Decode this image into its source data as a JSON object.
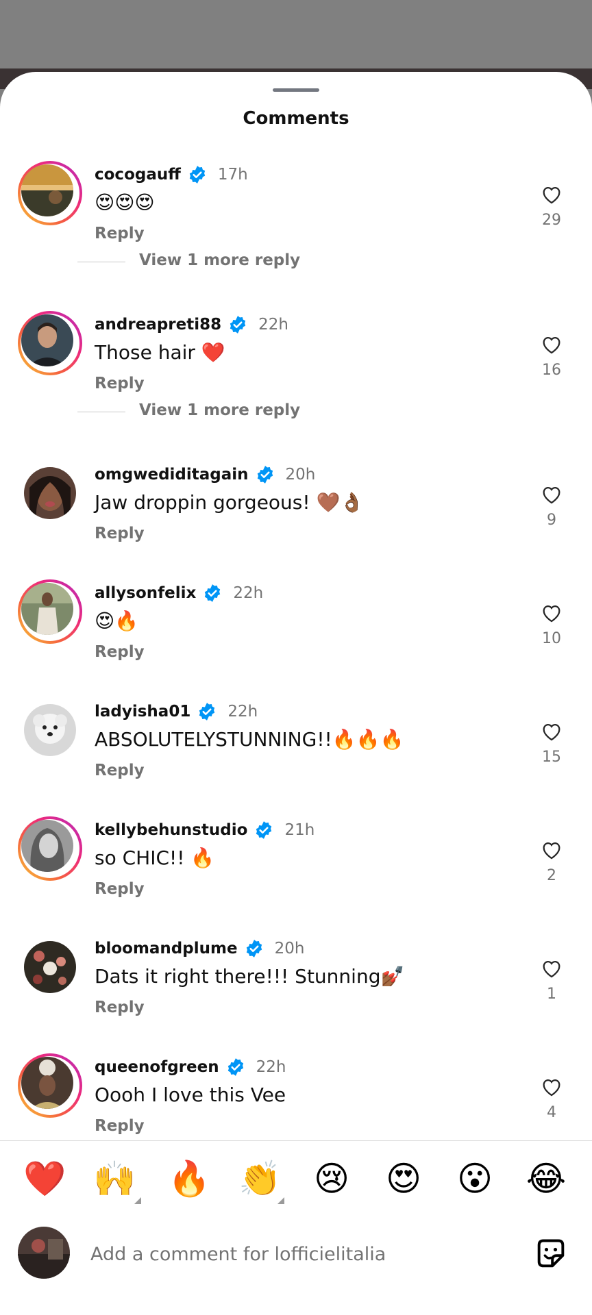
{
  "sheet": {
    "title": "Comments"
  },
  "comments": [
    {
      "username": "cocogauff",
      "time": "17h",
      "text": "😍😍😍",
      "reply": "Reply",
      "likes": "29",
      "view_more": "View 1 more reply"
    },
    {
      "username": "andreapreti88",
      "time": "22h",
      "text": "Those hair ❤️",
      "reply": "Reply",
      "likes": "16",
      "view_more": "View 1 more reply"
    },
    {
      "username": "omgwediditagain",
      "time": "20h",
      "text": "Jaw droppin gorgeous! 🤎👌🏾",
      "reply": "Reply",
      "likes": "9"
    },
    {
      "username": "allysonfelix",
      "time": "22h",
      "text": "😍🔥",
      "reply": "Reply",
      "likes": "10"
    },
    {
      "username": "ladyisha01",
      "time": "22h",
      "text": "ABSOLUTELYSTUNNING!!🔥🔥🔥",
      "reply": "Reply",
      "likes": "15"
    },
    {
      "username": "kellybehunstudio",
      "time": "21h",
      "text": "so CHIC!! 🔥",
      "reply": "Reply",
      "likes": "2"
    },
    {
      "username": "bloomandplume",
      "time": "20h",
      "text": "Dats it right there!!! Stunning💅🏾",
      "reply": "Reply",
      "likes": "1"
    },
    {
      "username": "queenofgreen",
      "time": "22h",
      "text": "Oooh I love this Vee",
      "reply": "Reply",
      "likes": "4"
    }
  ],
  "quick_reactions": [
    "❤️",
    "🙌",
    "🔥",
    "👏",
    "😢",
    "😍",
    "😮",
    "😂"
  ],
  "composer": {
    "placeholder": "Add a comment for lofficielitalia"
  },
  "colors": {
    "verified": "#0095f6",
    "secondary_text": "#737373",
    "heart_red": "#ed1c24"
  }
}
